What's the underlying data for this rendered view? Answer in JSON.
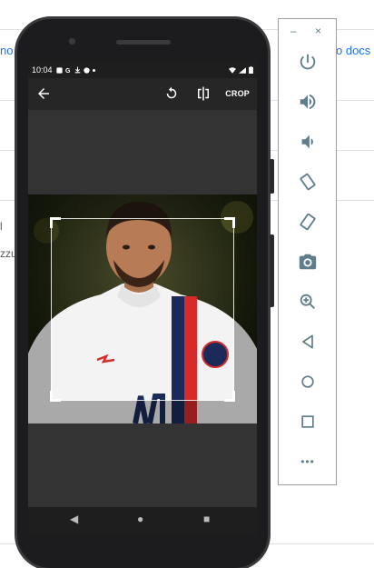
{
  "background": {
    "link_right": "o docs",
    "link_left": "no",
    "text_left": "zzu",
    "marker": "l"
  },
  "phone": {
    "status_time": "10:04",
    "toolbar": {
      "back_icon": "arrow-left-icon",
      "rotate_icon": "rotate-icon",
      "flip_icon": "flip-icon",
      "crop_label": "CROP"
    },
    "nav": {
      "back": "◀",
      "home": "●",
      "recents": "■"
    }
  },
  "emulator_panel": {
    "minimize": "–",
    "close": "×",
    "buttons": [
      "power-icon",
      "volume-up-icon",
      "volume-down-icon",
      "rotate-left-icon",
      "rotate-right-icon",
      "camera-icon",
      "zoom-icon",
      "back-icon",
      "home-icon",
      "overview-icon",
      "more-icon"
    ],
    "more_label": "•••"
  },
  "colors": {
    "panel_icon": "#607d8b",
    "jersey_red": "#d62b2b",
    "jersey_navy": "#1c2a5a"
  }
}
